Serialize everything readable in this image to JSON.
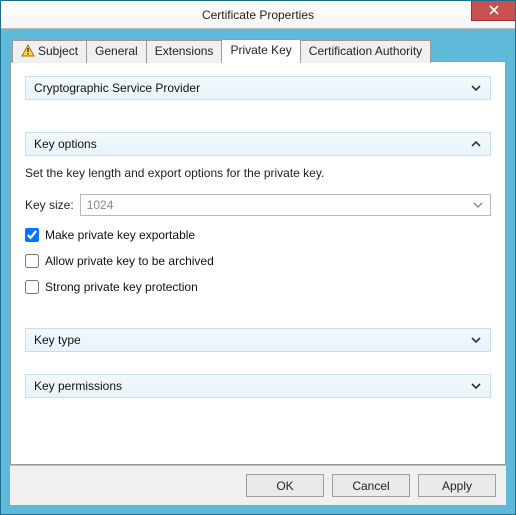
{
  "window": {
    "title": "Certificate Properties"
  },
  "tabs": [
    {
      "label": "Subject"
    },
    {
      "label": "General"
    },
    {
      "label": "Extensions"
    },
    {
      "label": "Private Key"
    },
    {
      "label": "Certification Authority"
    }
  ],
  "sections": {
    "csp": {
      "title": "Cryptographic Service Provider"
    },
    "keyOptions": {
      "title": "Key options",
      "desc": "Set the key length and export options for the private key.",
      "keySizeLabel": "Key size:",
      "keySizeValue": "1024",
      "exportable": "Make private key exportable",
      "archived": "Allow private key to be archived",
      "strong": "Strong private key protection"
    },
    "keyType": {
      "title": "Key type"
    },
    "keyPerms": {
      "title": "Key permissions"
    }
  },
  "buttons": {
    "ok": "OK",
    "cancel": "Cancel",
    "apply": "Apply"
  }
}
